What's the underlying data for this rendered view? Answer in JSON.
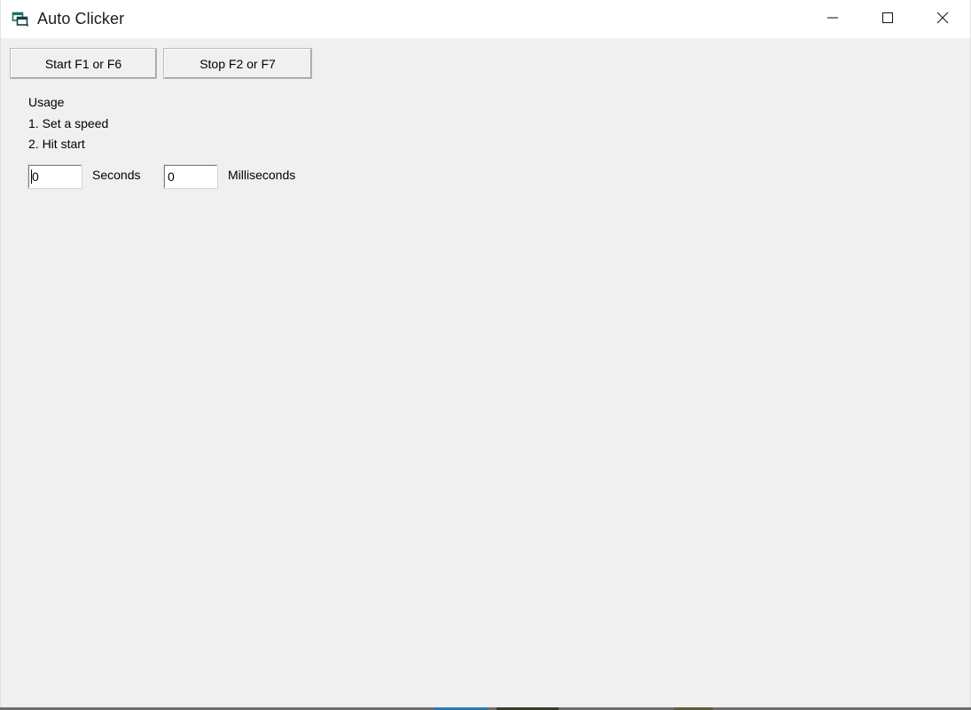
{
  "window": {
    "title": "Auto Clicker",
    "icon": "form-window-icon",
    "background_color": "#f0f0f0",
    "titlebar_color": "#ffffff"
  },
  "caption_buttons": [
    {
      "name": "minimize-button",
      "icon": "minimize-icon",
      "label": "Minimize"
    },
    {
      "name": "maximize-button",
      "icon": "maximize-icon",
      "label": "Maximize"
    },
    {
      "name": "close-button",
      "icon": "close-icon",
      "label": "Close"
    }
  ],
  "toolbar": {
    "start_label": "Start F1 or F6",
    "stop_label": "Stop F2 or F7"
  },
  "usage": {
    "heading": "Usage",
    "steps": [
      "1. Set a speed",
      "2. Hit start"
    ]
  },
  "speed": {
    "seconds": {
      "value": "0",
      "label": "Seconds",
      "focused": true
    },
    "milliseconds": {
      "value": "0",
      "label": "Milliseconds",
      "focused": false
    }
  }
}
